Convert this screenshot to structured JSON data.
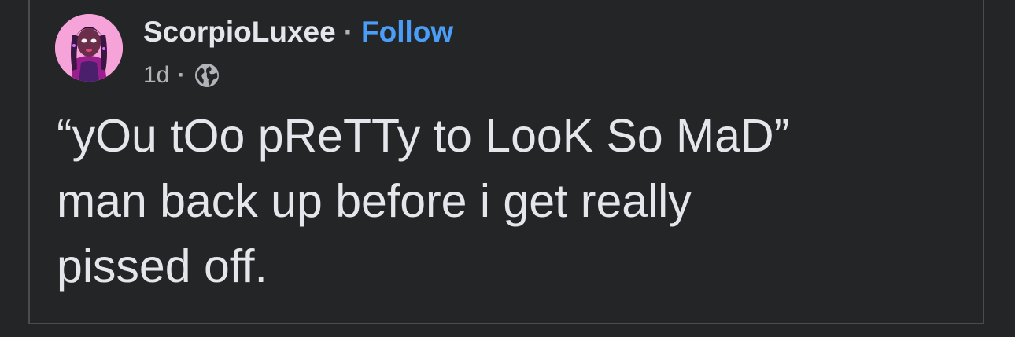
{
  "post": {
    "author": {
      "name": "ScorpioLuxee",
      "avatar_icon": "profile-avatar-image"
    },
    "separator": "·",
    "follow_label": "Follow",
    "timestamp": "1d",
    "meta_separator": "·",
    "privacy_icon": "globe-icon",
    "text_lines": [
      "“yOu tOo pReTTy to LooK So MaD”",
      "man back up before i get really",
      "pissed off."
    ]
  },
  "colors": {
    "background": "#242526",
    "text_primary": "#e4e6eb",
    "text_secondary": "#b0b3b8",
    "link": "#4b9ef7",
    "border": "#4b4c4f"
  }
}
